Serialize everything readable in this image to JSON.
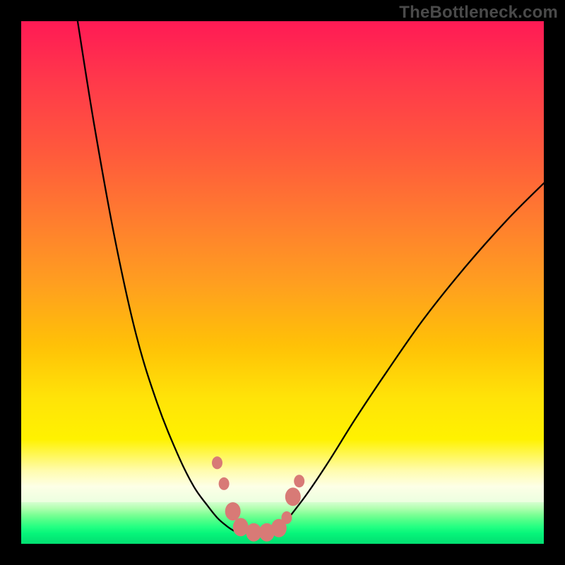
{
  "watermark_text": "TheBottleneck.com",
  "chart_data": {
    "type": "line",
    "title": "",
    "xlabel": "",
    "ylabel": "",
    "xlim": [
      0,
      100
    ],
    "ylim": [
      0,
      100
    ],
    "grid": false,
    "legend": false,
    "series": [
      {
        "name": "left-curve",
        "x": [
          10.8,
          14,
          18,
          22,
          26,
          30,
          33,
          35.5,
          37.5,
          39.2,
          40.5,
          41.5
        ],
        "y": [
          100,
          80,
          58,
          40,
          27,
          17,
          11,
          7.5,
          5,
          3.5,
          2.6,
          2.2
        ]
      },
      {
        "name": "right-curve",
        "x": [
          48.5,
          50,
          52,
          55,
          59,
          64,
          70,
          77,
          85,
          93,
          100
        ],
        "y": [
          2.2,
          3.5,
          6,
          10,
          16,
          24,
          33,
          43,
          53,
          62,
          69
        ]
      },
      {
        "name": "valley-floor",
        "x": [
          41.5,
          43.5,
          45.5,
          47.5,
          48.5
        ],
        "y": [
          2.2,
          2.0,
          2.0,
          2.0,
          2.2
        ]
      }
    ],
    "markers": [
      {
        "x": 37.5,
        "y": 15.5,
        "size": "sm"
      },
      {
        "x": 38.8,
        "y": 11.5,
        "size": "sm"
      },
      {
        "x": 40.5,
        "y": 6.2,
        "size": "lg"
      },
      {
        "x": 42.0,
        "y": 3.2,
        "size": "lg"
      },
      {
        "x": 44.5,
        "y": 2.2,
        "size": "lg"
      },
      {
        "x": 47.0,
        "y": 2.2,
        "size": "lg"
      },
      {
        "x": 49.3,
        "y": 3.0,
        "size": "lg"
      },
      {
        "x": 50.8,
        "y": 5.0,
        "size": "sm"
      },
      {
        "x": 52.0,
        "y": 9.0,
        "size": "lg"
      },
      {
        "x": 53.2,
        "y": 12.0,
        "size": "sm"
      }
    ],
    "gradient_stops": [
      {
        "pos": 0,
        "color": "#ff1a55"
      },
      {
        "pos": 50,
        "color": "#ff9e20"
      },
      {
        "pos": 80,
        "color": "#fff200"
      },
      {
        "pos": 100,
        "color": "#03e072"
      }
    ]
  }
}
